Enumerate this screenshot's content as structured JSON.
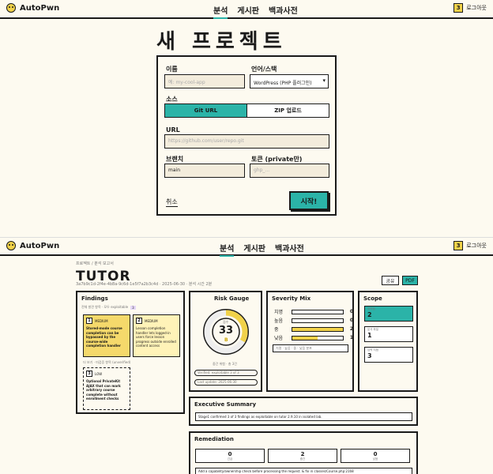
{
  "app": {
    "name": "AutoPwn"
  },
  "nav": {
    "items": [
      "분석",
      "게시판",
      "백과사전"
    ],
    "badge": "3",
    "user": "로그아웃"
  },
  "new_project": {
    "title": "새 프로젝트",
    "name_label": "이름",
    "name_placeholder": "예: my-cool-app",
    "lang_label": "언어/스택",
    "lang_value": "WordPress (PHP 플러그인)",
    "source_label": "소스",
    "source_git": "Git URL",
    "source_zip": "ZIP 업로드",
    "url_label": "URL",
    "url_placeholder": "https://github.com/user/repo.git",
    "branch_label": "브랜치",
    "branch_value": "main",
    "token_label": "토큰 (private만)",
    "token_placeholder": "ghp_...",
    "cancel": "취소",
    "start": "시작!"
  },
  "report": {
    "breadcrumb": "프로젝트 / 분석 보고서",
    "title": "TUTOR",
    "meta": "3a7b9c1d-2f4e-4b8a-9c6d-1e5f7a2b3c4d · 2025-06-30 · 분석 시간 2분",
    "share": "공유",
    "pdf": "PDF",
    "findings": {
      "title": "Findings",
      "subtitle": "전체 발견 항목 · 모두 exploitable",
      "count": "3",
      "items": [
        {
          "num": "1",
          "sev": "MEDIUM",
          "text": "Stored-mode course completion can be bypassed by the course-wide completion handler",
          "foot": "tutor/classes/Course.php"
        },
        {
          "num": "2",
          "sev": "MEDIUM",
          "text": "Lesson completion handler lets logged-in users force lesson progress outside enrolled content access",
          "foot": "tutor/classes/Lesson.php"
        },
        {
          "num": "3",
          "sev": "LOW",
          "text": "Optional PrivateKit AJAX that can mark arbitrary course complete without enrollment checks",
          "foot": "tutor/classes/Ajax.php"
        }
      ],
      "more_label": "더 보기 · 미검증 항목 (unverified)"
    },
    "risk": {
      "title": "Risk Gauge",
      "score": "33",
      "score_label": "점수",
      "grade": "B",
      "gauge_fraction": 0.33,
      "caption": "중간 위험 · 총 3건",
      "legend": [
        "Verified: exploitable 3 of 3",
        "Last update: 2025-06-30"
      ]
    },
    "severity": {
      "title": "Severity Mix",
      "rows": [
        {
          "label": "치명",
          "count": 0,
          "fraction": 0
        },
        {
          "label": "높음",
          "count": 0,
          "fraction": 0
        },
        {
          "label": "중",
          "count": 2,
          "fraction": 1
        },
        {
          "label": "낮음",
          "count": 1,
          "fraction": 0.5
        }
      ],
      "footer": "치명 · 높음 · 중 · 낮음 분포"
    },
    "scope": {
      "title": "Scope",
      "boxes": [
        {
          "label": "취약점",
          "value": "2",
          "active": true
        },
        {
          "label": "분석 파일",
          "value": "1",
          "active": false
        },
        {
          "label": "입력 지점",
          "value": "3",
          "active": false
        }
      ]
    },
    "summary": {
      "title": "Executive Summary",
      "text": "Stage1 confirmed 3 of 3 findings as exploitable on tutor 2.9.10 in isolated lab."
    },
    "remediation": {
      "title": "Remediation",
      "stats": [
        {
          "value": "0",
          "label": "긴급"
        },
        {
          "value": "2",
          "label": "중간"
        },
        {
          "value": "0",
          "label": "낮음"
        }
      ],
      "item": "Add a capability/ownership check before processing the request. & fix in classes/Course.php:2168"
    }
  },
  "colors": {
    "accent": "#2bb3a8",
    "yellow": "#f1d24a",
    "ink": "#1a1a1a",
    "paper": "#fdfaf0"
  }
}
